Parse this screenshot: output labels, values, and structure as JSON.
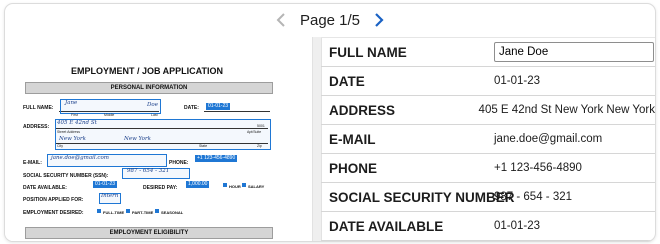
{
  "pager": {
    "label": "Page 1/5",
    "prev_icon": "chevron-left-icon",
    "next_icon": "chevron-right-icon"
  },
  "document": {
    "title": "EMPLOYMENT / JOB APPLICATION",
    "section_personal": "PERSONAL INFORMATION",
    "section_eligibility": "EMPLOYMENT ELIGIBILITY",
    "labels": {
      "full_name": "FULL NAME:",
      "date": "DATE:",
      "address": "ADDRESS:",
      "email": "E-MAIL:",
      "phone": "PHONE:",
      "ssn": "SOCIAL SECURITY NUMBER (SSN):",
      "date_available": "DATE AVAILABLE:",
      "desired_pay": "DESIRED PAY:",
      "position": "POSITION APPLIED FOR:",
      "employment_desired": "EMPLOYMENT DESIRED:",
      "first": "First",
      "middle": "Middle",
      "last": "Last",
      "street": "Street Address",
      "apt": "Apt/Suite",
      "city": "City",
      "state": "State",
      "zip": "Zip",
      "hour": "HOUR",
      "salary": "SALARY",
      "full_time": "FULL-TIME",
      "part_time": "PART-TIME",
      "seasonal": "SEASONAL"
    },
    "handwritten": {
      "first": "Jane",
      "last": "Doe",
      "date": "01-01-23",
      "street": "405 E 42nd St",
      "apt": "5001",
      "city": "New York",
      "state": "New York",
      "email": "jane.doe@gmail.com",
      "phone": "+1 123-456-4890",
      "ssn": "987 - 654 - 321",
      "date_available": "01-01-23",
      "pay": "1,000.00",
      "position": "Intern"
    }
  },
  "fields": [
    {
      "label": "FULL NAME",
      "value": "Jane Doe",
      "editable": true
    },
    {
      "label": "DATE",
      "value": "01-01-23"
    },
    {
      "label": "ADDRESS",
      "value": "405 E 42nd St New York New York"
    },
    {
      "label": "E-MAIL",
      "value": "jane.doe@gmail.com"
    },
    {
      "label": "PHONE",
      "value": "+1 123-456-4890"
    },
    {
      "label": "SOCIAL SECURITY NUMBER",
      "value": "987 - 654 - 321"
    },
    {
      "label": "DATE AVAILABLE",
      "value": "01-01-23"
    }
  ],
  "colors": {
    "accent": "#1a62c4",
    "highlight": "#1f77d4"
  }
}
